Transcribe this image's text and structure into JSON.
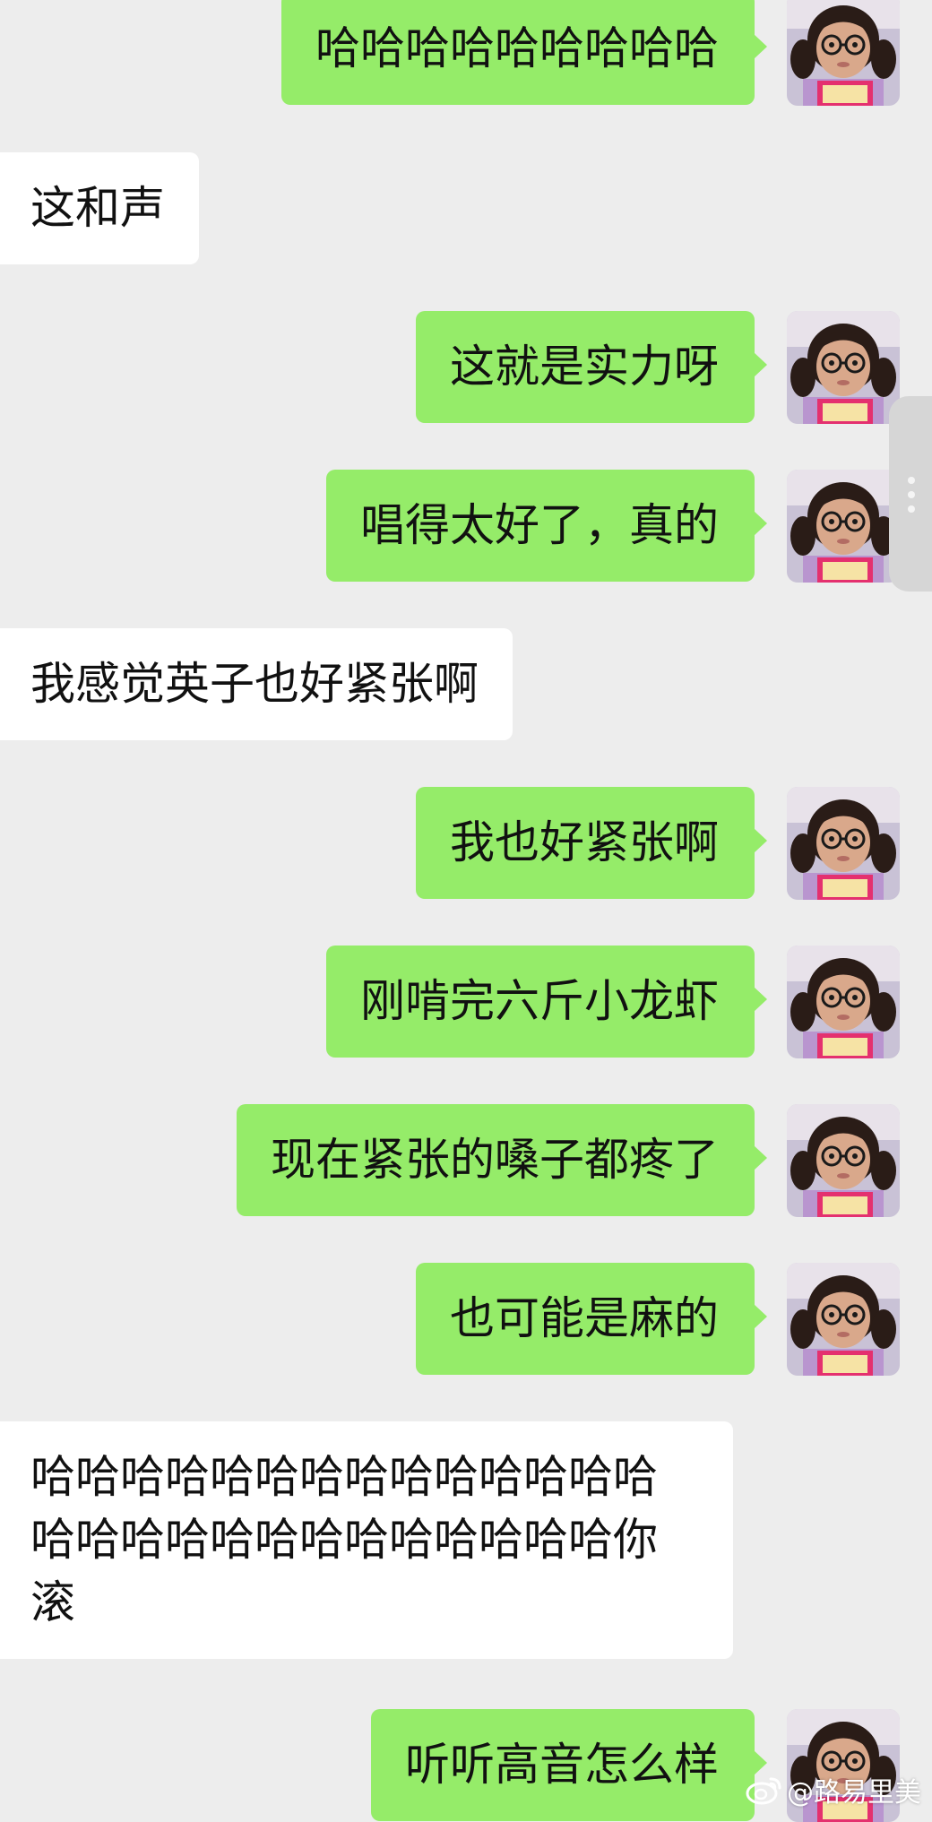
{
  "messages": [
    {
      "side": "me",
      "text": "哈哈哈哈哈哈哈哈哈"
    },
    {
      "side": "them",
      "text": "这和声"
    },
    {
      "side": "me",
      "text": "这就是实力呀"
    },
    {
      "side": "me",
      "text": "唱得太好了，真的"
    },
    {
      "side": "them",
      "text": "我感觉英子也好紧张啊"
    },
    {
      "side": "me",
      "text": "我也好紧张啊"
    },
    {
      "side": "me",
      "text": "刚啃完六斤小龙虾"
    },
    {
      "side": "me",
      "text": "现在紧张的嗓子都疼了"
    },
    {
      "side": "me",
      "text": "也可能是麻的"
    },
    {
      "side": "them",
      "text": "哈哈哈哈哈哈哈哈哈哈哈哈哈哈哈哈哈哈哈哈哈哈哈哈哈哈哈你滚"
    },
    {
      "side": "me",
      "text": "听听高音怎么样"
    }
  ],
  "colors": {
    "background": "#ededed",
    "my_bubble": "#95ec69",
    "their_bubble": "#ffffff"
  },
  "icons": {
    "avatar": "avatar-girl-with-glasses",
    "side_handle": "more-vertical-icon",
    "watermark": "weibo-icon"
  },
  "watermark": {
    "text": "@路易里美"
  }
}
